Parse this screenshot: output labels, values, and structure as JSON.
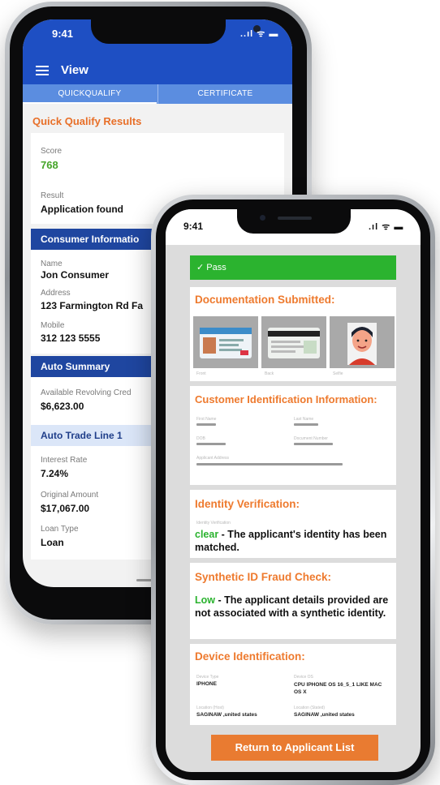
{
  "back_phone": {
    "time": "9:41",
    "status_icons": "..ıl ᯤ ▬",
    "header_title": "View",
    "tabs": [
      {
        "label": "QUICKQUALIFY"
      },
      {
        "label": "CERTIFICATE"
      }
    ],
    "section_title": "Quick Qualify Results",
    "score": {
      "label": "Score",
      "value": "768"
    },
    "result": {
      "label": "Result",
      "value": "Application found"
    },
    "consumer_section": "Consumer Informatio",
    "consumer": {
      "name_label": "Name",
      "name": "Jon Consumer",
      "address_label": "Address",
      "address": "123 Farmington Rd Fa",
      "mobile_label": "Mobile",
      "mobile": "312 123 5555"
    },
    "auto_summary": "Auto Summary",
    "revolving": {
      "label": "Available Revolving Cred",
      "value": "$6,623.00"
    },
    "trade_line": "Auto Trade Line 1",
    "interest": {
      "label": "Interest Rate",
      "value": "7.24%"
    },
    "original": {
      "label": "Original Amount",
      "value": "$17,067.00"
    },
    "loan_type": {
      "label": "Loan Type",
      "value": "Loan"
    }
  },
  "front_phone": {
    "time": "9:41",
    "status_icons": ".ıl ᯤ ▬",
    "pass_label": "✓ Pass",
    "doc_title": "Documentation Submitted:",
    "doc_labels": [
      "Front",
      "Back",
      "Selfie"
    ],
    "cust_title": "Customer Identification Information:",
    "cust_fields": [
      {
        "label": "First Name"
      },
      {
        "label": "Last Name"
      },
      {
        "label": "DOB"
      },
      {
        "label": "Document Number"
      },
      {
        "label": "Applicant Address"
      }
    ],
    "idv_title": "Identity Verification:",
    "idv_sublabel": "Identity Verification",
    "idv_status": "clear",
    "idv_text": " - The applicant's identity has been matched.",
    "synth_title": "Synthetic ID Fraud Check:",
    "synth_status": "Low",
    "synth_text": " - The applicant details provided are not associated with a synthetic identity.",
    "device_title": "Device Identification:",
    "device": {
      "type_label": "Device Type",
      "type": "IPHONE",
      "os_label": "Device OS",
      "os": "CPU IPHONE OS 16_5_1 LIKE MAC OS X",
      "loc_ip_label": "Location (Host)",
      "loc_ip": "SAGINAW ,united states",
      "loc_label": "Location (Stated)",
      "loc": "SAGINAW ,united states"
    },
    "return_button": "Return to Applicant List"
  },
  "colors": {
    "header_blue": "#1e4fc3",
    "section_navy": "#1f46a0",
    "accent_orange": "#ee7a2e",
    "pass_green": "#2bb32f"
  }
}
